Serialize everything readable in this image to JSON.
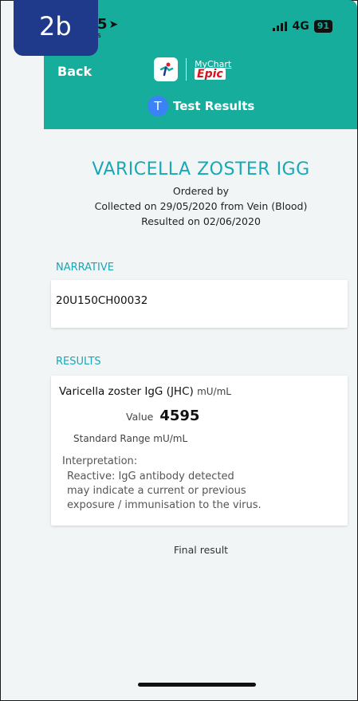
{
  "badge": "2b",
  "status": {
    "time": "5",
    "sub": "s",
    "network": "4G",
    "battery": "91"
  },
  "header": {
    "back_label": "Back",
    "brand_mychart": "MyChart",
    "brand_epic": "Epic",
    "tab_initial": "T",
    "tab_label": "Test Results"
  },
  "test": {
    "title": "VARICELLA ZOSTER IGG",
    "ordered_by": "Ordered by",
    "collected": "Collected on 29/05/2020 from Vein (Blood)",
    "resulted": "Resulted on 02/06/2020"
  },
  "narrative": {
    "label": "NARRATIVE",
    "text": "20U150CH00032"
  },
  "results": {
    "label": "RESULTS",
    "name": "Varicella zoster IgG (JHC)",
    "unit": "mU/mL",
    "value_label": "Value",
    "value": "4595",
    "range": "Standard Range  mU/mL",
    "interp_label": "Interpretation:",
    "interp_lines": [
      "Reactive: IgG antibody detected",
      "may indicate a current or previous",
      "exposure / immunisation to the virus."
    ]
  },
  "final_label": "Final result",
  "colors": {
    "header": "#17ad9c",
    "accent": "#17a8b6",
    "badge": "#1f3a8a"
  }
}
